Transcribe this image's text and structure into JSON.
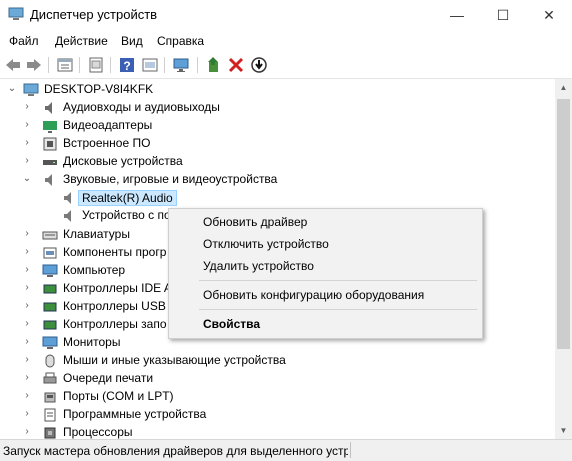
{
  "window": {
    "title": "Диспетчер устройств",
    "minimize": "—",
    "maximize": "☐",
    "close": "✕"
  },
  "menu": [
    "Файл",
    "Действие",
    "Вид",
    "Справка"
  ],
  "toolbar_icons": [
    "back-icon",
    "forward-icon",
    "properties-view-icon",
    "hidden-devices-icon",
    "help-icon",
    "resources-icon",
    "monitor-icon",
    "update-driver-icon",
    "uninstall-x-icon",
    "disable-device-icon"
  ],
  "tree": {
    "root": "DESKTOP-V8I4KFK",
    "items": [
      {
        "label": "Аудиовходы и аудиовыходы",
        "icon": "audio-io-icon"
      },
      {
        "label": "Видеоадаптеры",
        "icon": "display-adapter-icon"
      },
      {
        "label": "Встроенное ПО",
        "icon": "firmware-icon"
      },
      {
        "label": "Дисковые устройства",
        "icon": "disk-drive-icon"
      },
      {
        "label": "Звуковые, игровые и видеоустройства",
        "icon": "speaker-icon",
        "expanded": true
      },
      {
        "label": "Realtek(R) Audio",
        "icon": "speaker-icon",
        "child": true,
        "selected": true
      },
      {
        "label": "Устройство с по",
        "icon": "speaker-icon",
        "child": true
      },
      {
        "label": "Клавиатуры",
        "icon": "keyboard-icon"
      },
      {
        "label": "Компоненты прогр",
        "icon": "software-component-icon"
      },
      {
        "label": "Компьютер",
        "icon": "computer-icon"
      },
      {
        "label": "Контроллеры IDE A",
        "icon": "ide-controller-icon"
      },
      {
        "label": "Контроллеры USB",
        "icon": "usb-controller-icon"
      },
      {
        "label": "Контроллеры запо",
        "icon": "storage-controller-icon"
      },
      {
        "label": "Мониторы",
        "icon": "monitor-icon"
      },
      {
        "label": "Мыши и иные указывающие устройства",
        "icon": "mouse-icon"
      },
      {
        "label": "Очереди печати",
        "icon": "printer-icon"
      },
      {
        "label": "Порты (COM и LPT)",
        "icon": "port-icon"
      },
      {
        "label": "Программные устройства",
        "icon": "software-device-icon"
      },
      {
        "label": "Процессоры",
        "icon": "processor-icon"
      }
    ]
  },
  "context_menu": {
    "update_driver": "Обновить драйвер",
    "disable_device": "Отключить устройство",
    "uninstall_device": "Удалить устройство",
    "scan_hardware": "Обновить конфигурацию оборудования",
    "properties": "Свойства"
  },
  "status": {
    "text": "Запуск мастера обновления драйверов для выделенного устро"
  }
}
